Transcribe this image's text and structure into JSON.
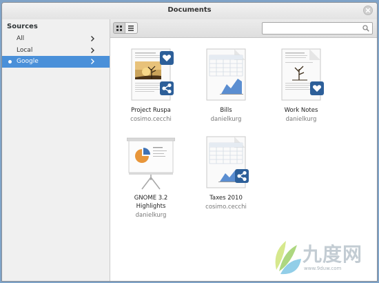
{
  "window": {
    "title": "Documents"
  },
  "sidebar": {
    "header": "Sources",
    "items": [
      {
        "label": "All",
        "active": false
      },
      {
        "label": "Local",
        "active": false
      },
      {
        "label": "Google",
        "active": true
      }
    ]
  },
  "toolbar": {
    "search_placeholder": ""
  },
  "documents": [
    {
      "name": "Project Ruspa",
      "author": "cosimo.cecchi",
      "type": "document",
      "favorite": true,
      "shared": true
    },
    {
      "name": "Bills",
      "author": "danielkurg",
      "type": "spreadsheet",
      "favorite": false,
      "shared": false
    },
    {
      "name": "Work Notes",
      "author": "danielkurg",
      "type": "document",
      "favorite": true,
      "shared": false
    },
    {
      "name": "GNOME 3.2 Highlights",
      "name_line1": "GNOME 3.2",
      "name_line2": "Highlights",
      "author": "danielkurg",
      "type": "presentation",
      "favorite": false,
      "shared": false
    },
    {
      "name": "Taxes 2010",
      "author": "cosimo.cecchi",
      "type": "spreadsheet",
      "favorite": false,
      "shared": true
    }
  ],
  "watermark": {
    "brand": "九度网",
    "url": "www.9duw.com"
  },
  "colors": {
    "accent": "#4a90d9",
    "emblem": "#2d5f99",
    "chart": "#5b8ed1"
  }
}
